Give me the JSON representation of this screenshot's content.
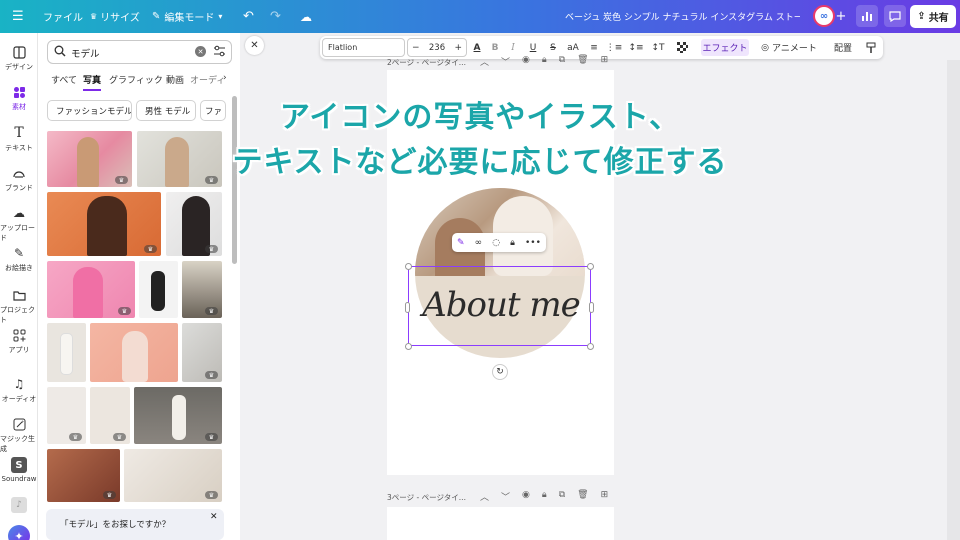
{
  "topbar": {
    "menu_icon": "hamburger-icon",
    "file_label": "ファイル",
    "resize_label": "リサイズ",
    "edit_mode_label": "編集モード",
    "design_title": "ベージュ 炭色 シンプル ナチュラル インスタグラム ストーリー...",
    "share_label": "共有"
  },
  "rail": {
    "items": [
      {
        "label": "デザイン",
        "icon": "layout-icon"
      },
      {
        "label": "素材",
        "icon": "elements-icon"
      },
      {
        "label": "テキスト",
        "icon": "text-icon"
      },
      {
        "label": "ブランド",
        "icon": "brand-icon"
      },
      {
        "label": "アップロード",
        "icon": "upload-icon"
      },
      {
        "label": "お絵描き",
        "icon": "draw-icon"
      },
      {
        "label": "プロジェクト",
        "icon": "folder-icon"
      },
      {
        "label": "アプリ",
        "icon": "apps-icon"
      },
      {
        "label": "オーディオ",
        "icon": "music-icon"
      },
      {
        "label": "マジック生成",
        "icon": "magic-icon"
      },
      {
        "label": "Soundraw",
        "icon": "soundraw-icon"
      }
    ]
  },
  "panel": {
    "search_value": "モデル",
    "tabs": [
      "すべて",
      "写真",
      "グラフィック",
      "動画",
      "オーディ"
    ],
    "chips": [
      "ファッションモデル",
      "男性 モデル",
      "ファ"
    ],
    "suggest_text": "「モデル」をお探しですか？"
  },
  "toolbar": {
    "font": "Flatlion",
    "font_size": "236",
    "effects_label": "エフェクト",
    "animate_label": "アニメート",
    "position_label": "配置"
  },
  "pages": {
    "page2_label": "2ページ - ページタイ...",
    "page3_label": "3ページ - ページタイ...",
    "about_text": "About me"
  },
  "headline": {
    "line1": "アイコンの写真やイラスト、",
    "line2": "テキストなど必要に応じて修正する"
  },
  "colors": {
    "accent": "#7d2ae8",
    "headline": "#1ba6a9",
    "circle_bg": "#e6dccf"
  }
}
